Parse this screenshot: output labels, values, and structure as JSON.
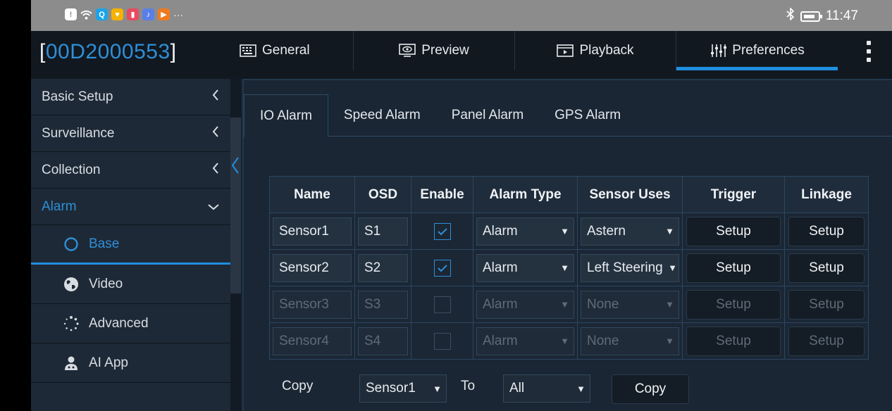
{
  "status_bar": {
    "time": "11:47",
    "overflow": "···"
  },
  "header": {
    "device_id": "00D2000553",
    "bracket_open": "[",
    "bracket_close": "]",
    "tabs": [
      {
        "label": "General",
        "icon": "keyboard-icon"
      },
      {
        "label": "Preview",
        "icon": "monitor-eye-icon"
      },
      {
        "label": "Playback",
        "icon": "film-icon"
      },
      {
        "label": "Preferences",
        "icon": "sliders-icon",
        "active": true
      }
    ]
  },
  "sidebar": {
    "groups": [
      {
        "label": "Basic Setup"
      },
      {
        "label": "Surveillance"
      },
      {
        "label": "Collection"
      },
      {
        "label": "Alarm",
        "expanded": true
      }
    ],
    "alarm_items": [
      {
        "label": "Base",
        "icon": "circle-icon",
        "active": true
      },
      {
        "label": "Video",
        "icon": "globe-icon"
      },
      {
        "label": "Advanced",
        "icon": "dotted-circle-icon"
      },
      {
        "label": "AI App",
        "icon": "user-nodes-icon"
      }
    ]
  },
  "sub_tabs": [
    "IO Alarm",
    "Speed Alarm",
    "Panel Alarm",
    "GPS Alarm"
  ],
  "table": {
    "headers": [
      "Name",
      "OSD",
      "Enable",
      "Alarm Type",
      "Sensor Uses",
      "Trigger",
      "Linkage"
    ],
    "rows": [
      {
        "name": "Sensor1",
        "osd": "S1",
        "enabled": true,
        "alarm_type": "Alarm",
        "sensor_use": "Astern",
        "trigger": "Setup",
        "linkage": "Setup"
      },
      {
        "name": "Sensor2",
        "osd": "S2",
        "enabled": true,
        "alarm_type": "Alarm",
        "sensor_use": "Left Steering",
        "trigger": "Setup",
        "linkage": "Setup"
      },
      {
        "name": "Sensor3",
        "osd": "S3",
        "enabled": false,
        "alarm_type": "Alarm",
        "sensor_use": "None",
        "trigger": "Setup",
        "linkage": "Setup"
      },
      {
        "name": "Sensor4",
        "osd": "S4",
        "enabled": false,
        "alarm_type": "Alarm",
        "sensor_use": "None",
        "trigger": "Setup",
        "linkage": "Setup"
      }
    ]
  },
  "copy": {
    "label": "Copy",
    "from": "Sensor1",
    "to_label": "To",
    "to": "All",
    "button": "Copy"
  },
  "colors": {
    "accent": "#1f8fe0",
    "background": "#182330",
    "header": "#111820"
  }
}
